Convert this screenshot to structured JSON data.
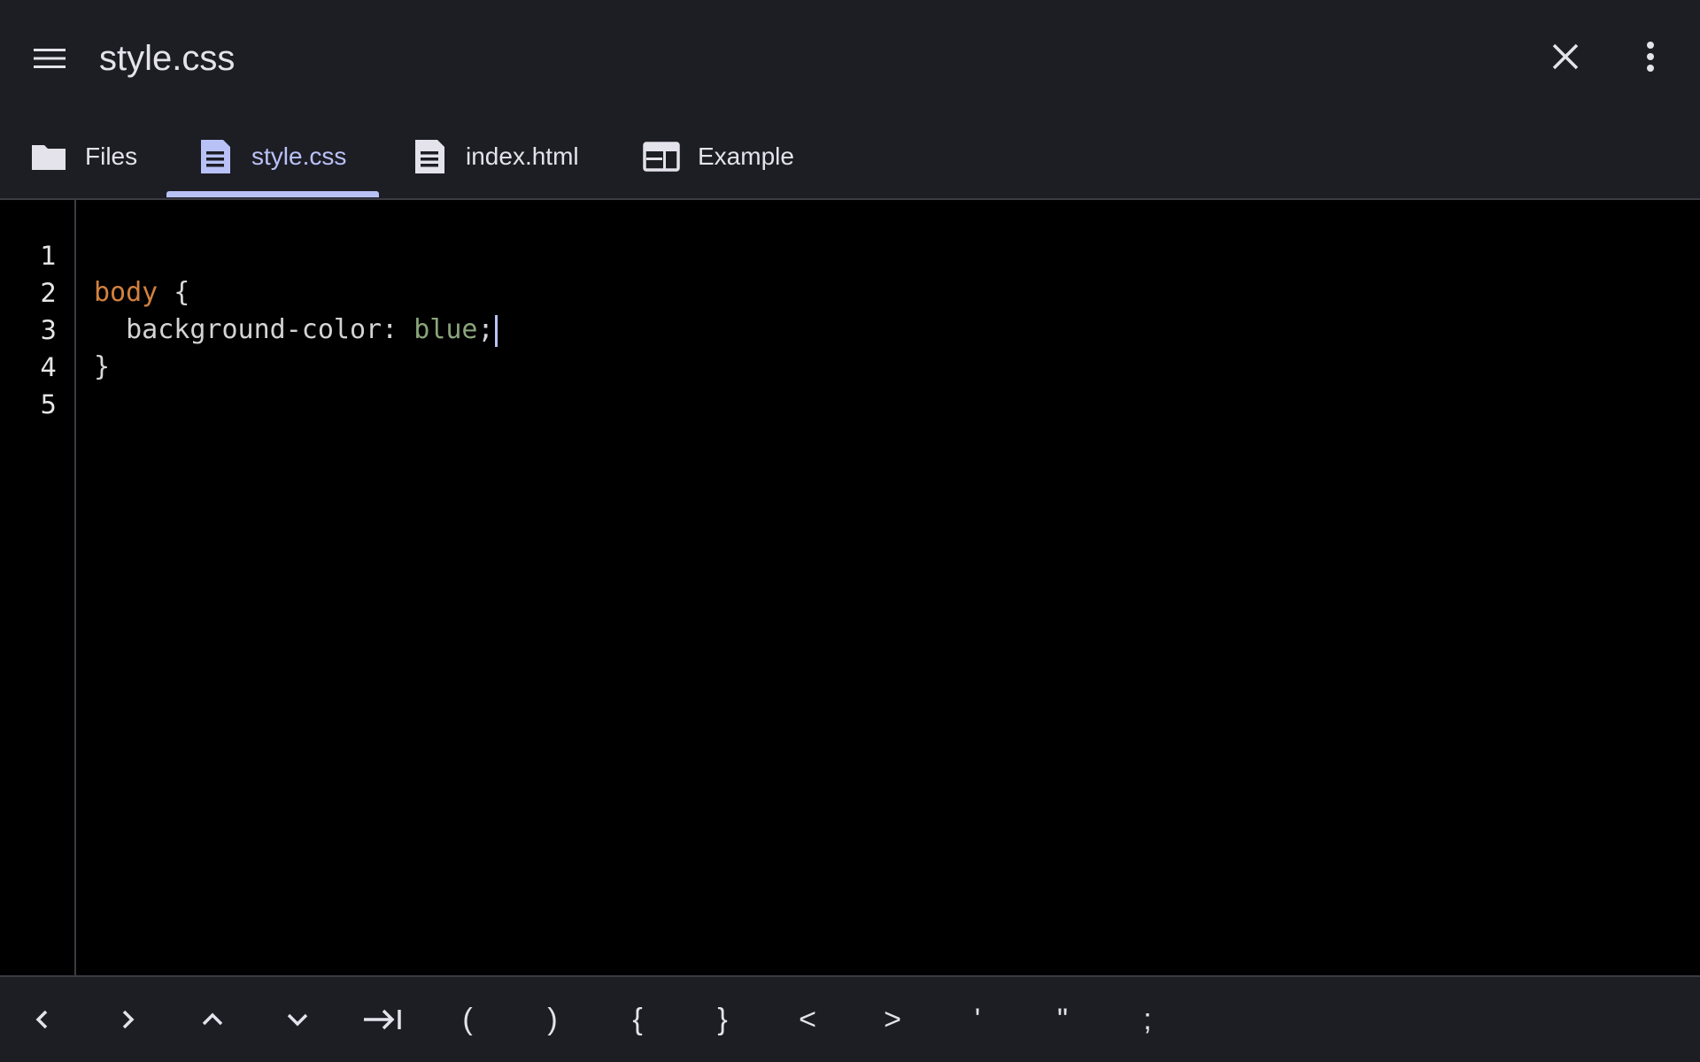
{
  "app_bar": {
    "title": "style.css",
    "menu_icon": "hamburger-menu-icon",
    "close_icon": "close-icon",
    "more_icon": "more-vert-icon"
  },
  "tabs": [
    {
      "label": "Files",
      "icon": "folder-icon",
      "active": false
    },
    {
      "label": "style.css",
      "icon": "document-icon",
      "active": true
    },
    {
      "label": "index.html",
      "icon": "document-icon",
      "active": false
    },
    {
      "label": "Example",
      "icon": "web-preview-icon",
      "active": false
    }
  ],
  "editor": {
    "line_numbers": [
      "1",
      "2",
      "3",
      "4",
      "5"
    ],
    "lines": [
      {
        "tokens": []
      },
      {
        "tokens": [
          {
            "text": "body",
            "kind": "selector"
          },
          {
            "text": " {",
            "kind": "brace"
          }
        ]
      },
      {
        "tokens": [
          {
            "text": "  background-color",
            "kind": "prop"
          },
          {
            "text": ": ",
            "kind": "prop"
          },
          {
            "text": "blue",
            "kind": "value"
          },
          {
            "text": ";",
            "kind": "prop"
          }
        ]
      },
      {
        "tokens": [
          {
            "text": "}",
            "kind": "brace"
          }
        ]
      },
      {
        "tokens": []
      }
    ],
    "cursor_line": 3
  },
  "keys": [
    {
      "label": "<",
      "name": "cursor-left-icon"
    },
    {
      "label": ">",
      "name": "cursor-right-icon"
    },
    {
      "label": "^",
      "name": "cursor-up-icon"
    },
    {
      "label": "v",
      "name": "cursor-down-icon"
    },
    {
      "label": "→|",
      "name": "tab-key-icon"
    },
    {
      "label": "(",
      "name": "key-open-paren"
    },
    {
      "label": ")",
      "name": "key-close-paren"
    },
    {
      "label": "{",
      "name": "key-open-brace"
    },
    {
      "label": "}",
      "name": "key-close-brace"
    },
    {
      "label": "<",
      "name": "key-less-than"
    },
    {
      "label": ">",
      "name": "key-greater-than"
    },
    {
      "label": "'",
      "name": "key-single-quote"
    },
    {
      "label": "\"",
      "name": "key-double-quote"
    },
    {
      "label": ";",
      "name": "key-semicolon"
    }
  ],
  "colors": {
    "bar_bg": "#1d1d24",
    "editor_bg": "#000000",
    "accent": "#b9c2f7",
    "selector": "#d2813f",
    "value": "#8aa57a"
  }
}
